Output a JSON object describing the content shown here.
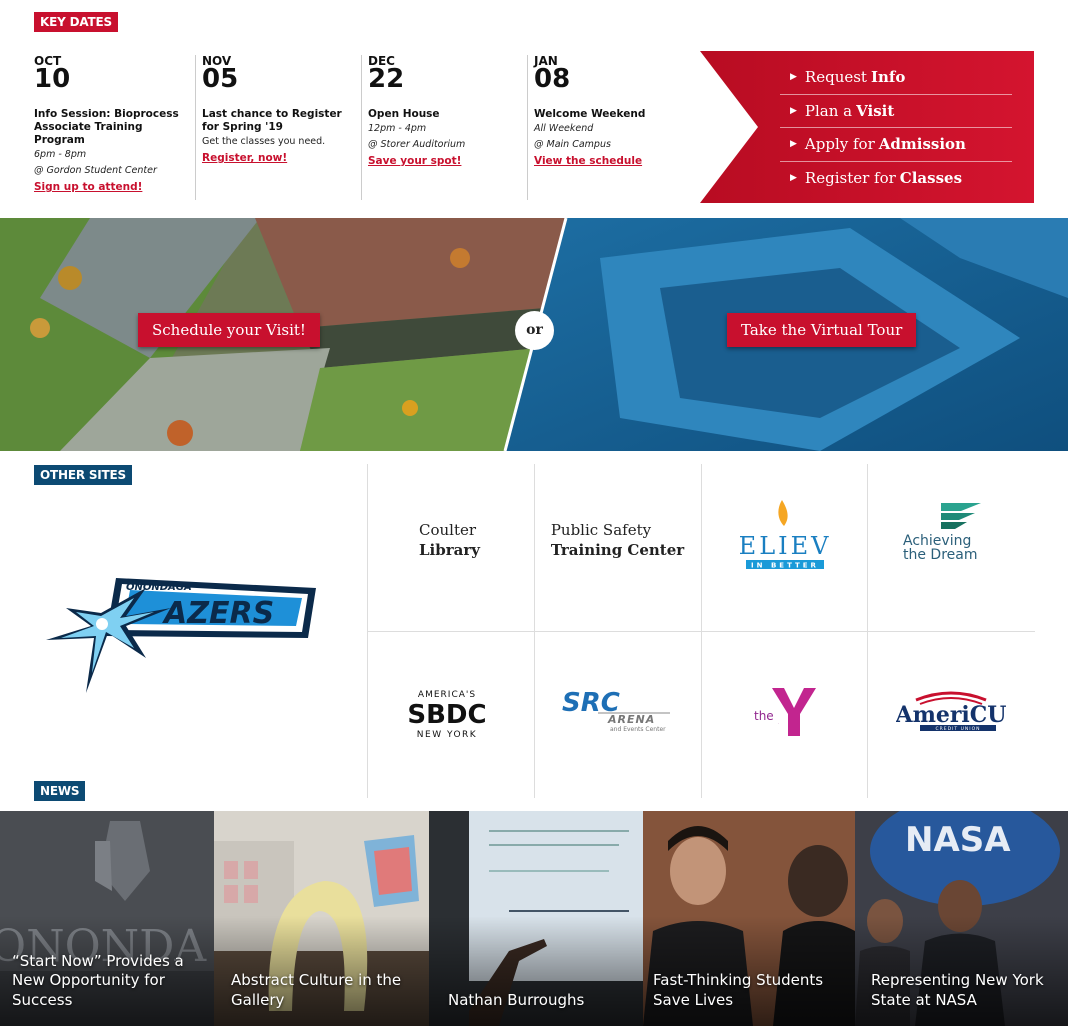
{
  "key_dates": {
    "label": "KEY DATES",
    "events": [
      {
        "month": "OCT",
        "day": "10",
        "title": "Info Session: Bioprocess Associate Training Program",
        "time": "6pm - 8pm",
        "location": "@ Gordon Student Center",
        "link": "Sign up to attend!"
      },
      {
        "month": "NOV",
        "day": "05",
        "title": "Last chance to Register for Spring '19",
        "detail": "Get the classes you need.",
        "link": "Register, now!"
      },
      {
        "month": "DEC",
        "day": "22",
        "title": "Open House",
        "time": "12pm - 4pm",
        "location": "@ Storer Auditorium",
        "link": "Save your spot!"
      },
      {
        "month": "JAN",
        "day": "08",
        "title": "Welcome Weekend",
        "time": "All Weekend",
        "location": "@ Main Campus",
        "link": "View the schedule"
      }
    ]
  },
  "cta": {
    "color": "#c8102e",
    "items": [
      {
        "prefix": "Request",
        "strong": "Info"
      },
      {
        "prefix": "Plan a",
        "strong": "Visit"
      },
      {
        "prefix": "Apply for",
        "strong": "Admission"
      },
      {
        "prefix": "Register for",
        "strong": "Classes"
      }
    ]
  },
  "hero": {
    "schedule_label": "Schedule your Visit!",
    "or_label": "or",
    "tour_label": "Take the Virtual Tour"
  },
  "other_sites": {
    "label": "OTHER SITES",
    "featured_logo": "ONONDAGA LAZERS",
    "logos": [
      {
        "line1": "Coulter",
        "line2": "Library"
      },
      {
        "line1": "Public Safety",
        "line2": "Training Center"
      },
      {
        "word": "BELIEVE",
        "sub": "IN BETTER"
      },
      {
        "line1": "Achieving",
        "line2": "the Dream"
      },
      {
        "top": "AMERICA'S",
        "main": "SBDC",
        "bottom": "NEW YORK"
      },
      {
        "main": "SRC",
        "sub": "ARENA",
        "sub2": "and Events Center"
      },
      {
        "prefix": "the",
        "main": "Y"
      },
      {
        "main": "AmeriCU",
        "sub": "CREDIT UNION"
      }
    ]
  },
  "news": {
    "label": "NEWS",
    "items": [
      {
        "title": "“Start Now” Provides a New Opportunity for Success"
      },
      {
        "title": "Abstract Culture in the Gallery"
      },
      {
        "title": "Nathan Burroughs"
      },
      {
        "title": "Fast-Thinking Students Save Lives"
      },
      {
        "title": "Representing New York State at NASA"
      }
    ]
  }
}
